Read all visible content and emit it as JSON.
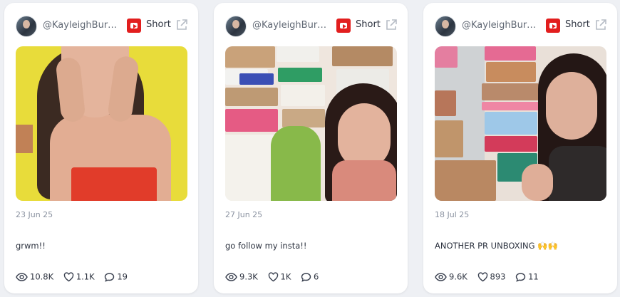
{
  "cards": [
    {
      "handle": "@KayleighBurs...",
      "platform_label": "Short",
      "date": "23 Jun 25",
      "caption": "grwm!!",
      "views": "10.8K",
      "likes": "1.1K",
      "comments": "19"
    },
    {
      "handle": "@KayleighBurs...",
      "platform_label": "Short",
      "date": "27 Jun 25",
      "caption": "go follow my insta!!",
      "views": "9.3K",
      "likes": "1K",
      "comments": "6"
    },
    {
      "handle": "@KayleighBurs...",
      "platform_label": "Short",
      "date": "18 Jul 25",
      "caption": "ANOTHER PR UNBOXING 🙌🙌",
      "views": "9.6K",
      "likes": "893",
      "comments": "11"
    }
  ],
  "icons": {
    "platform": "youtube-icon",
    "external": "external-link-icon",
    "views": "eye-icon",
    "likes": "heart-icon",
    "comments": "comment-icon"
  },
  "colors": {
    "brand_red": "#e21e1e",
    "muted_text": "#8a92a0",
    "page_bg": "#eef0f4"
  }
}
